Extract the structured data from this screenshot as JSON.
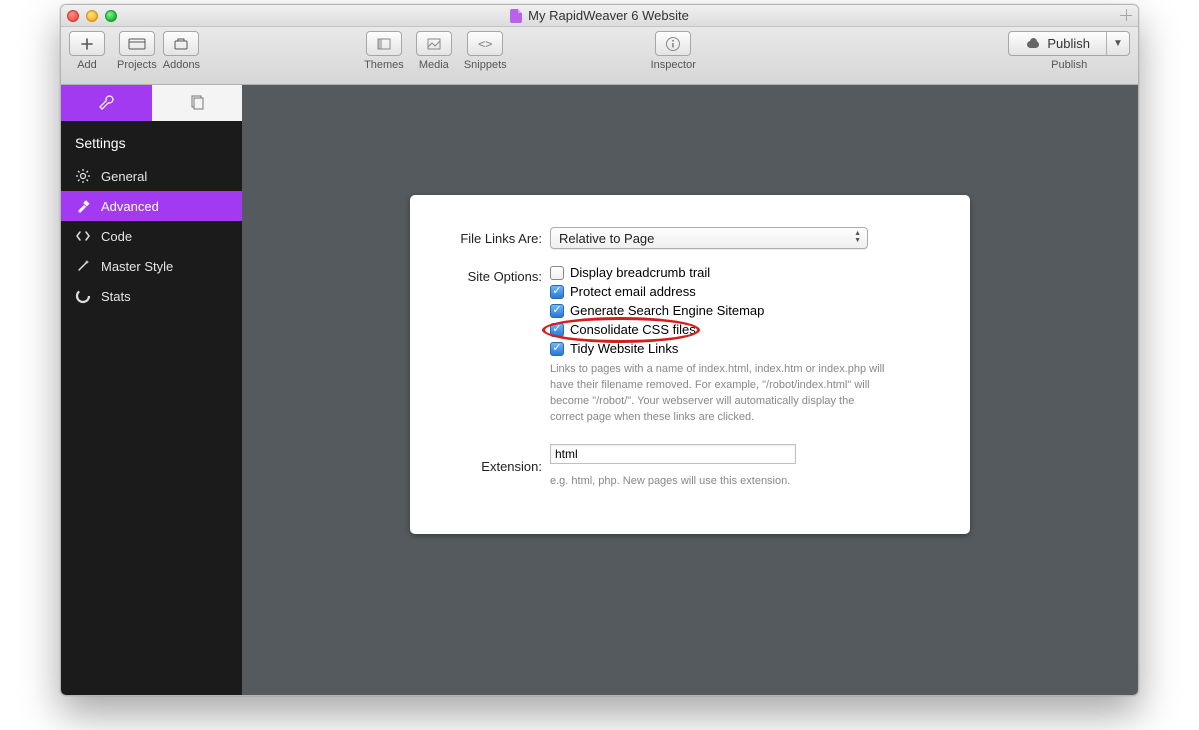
{
  "window": {
    "title": "My RapidWeaver 6 Website"
  },
  "toolbar": {
    "add_label": "Add",
    "projects_label": "Projects",
    "addons_label": "Addons",
    "themes_label": "Themes",
    "media_label": "Media",
    "snippets_label": "Snippets",
    "inspector_label": "Inspector",
    "publish_label": "Publish",
    "publish_section_label": "Publish"
  },
  "sidebar": {
    "header": "Settings",
    "items": [
      {
        "label": "General"
      },
      {
        "label": "Advanced"
      },
      {
        "label": "Code"
      },
      {
        "label": "Master Style"
      },
      {
        "label": "Stats"
      }
    ]
  },
  "panel": {
    "file_links_label": "File Links Are:",
    "file_links_value": "Relative to Page",
    "site_options_label": "Site Options:",
    "options": [
      {
        "label": "Display breadcrumb trail",
        "checked": false
      },
      {
        "label": "Protect email address",
        "checked": true
      },
      {
        "label": "Generate Search Engine Sitemap",
        "checked": true
      },
      {
        "label": "Consolidate CSS files",
        "checked": true
      },
      {
        "label": "Tidy Website Links",
        "checked": true
      }
    ],
    "tidy_help": "Links to pages with a name of index.html, index.htm or index.php will have their filename removed. For example, \"/robot/index.html\" will become \"/robot/\". Your webserver will automatically display the correct page when these links are clicked.",
    "extension_label": "Extension:",
    "extension_value": "html",
    "extension_help": "e.g. html, php. New pages will use this extension."
  }
}
